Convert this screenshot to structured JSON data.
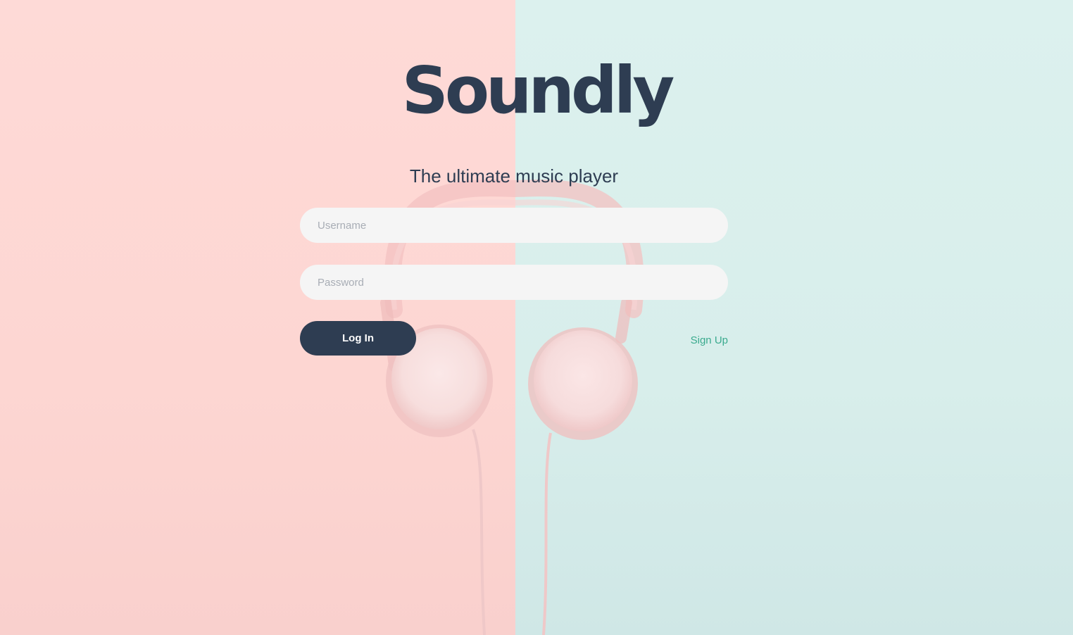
{
  "brand": {
    "logo_text": "Soundly",
    "tagline": "The ultimate music player"
  },
  "login_form": {
    "username_placeholder": "Username",
    "password_placeholder": "Password",
    "login_label": "Log In",
    "signup_label": "Sign Up"
  },
  "colors": {
    "left_background": "#fdd6d2",
    "right_background": "#d8eeeb",
    "primary": "#2e3d52",
    "link": "#3aaa8e",
    "input_background": "#f5f5f5"
  },
  "background_image": {
    "icon": "headphones-icon"
  }
}
